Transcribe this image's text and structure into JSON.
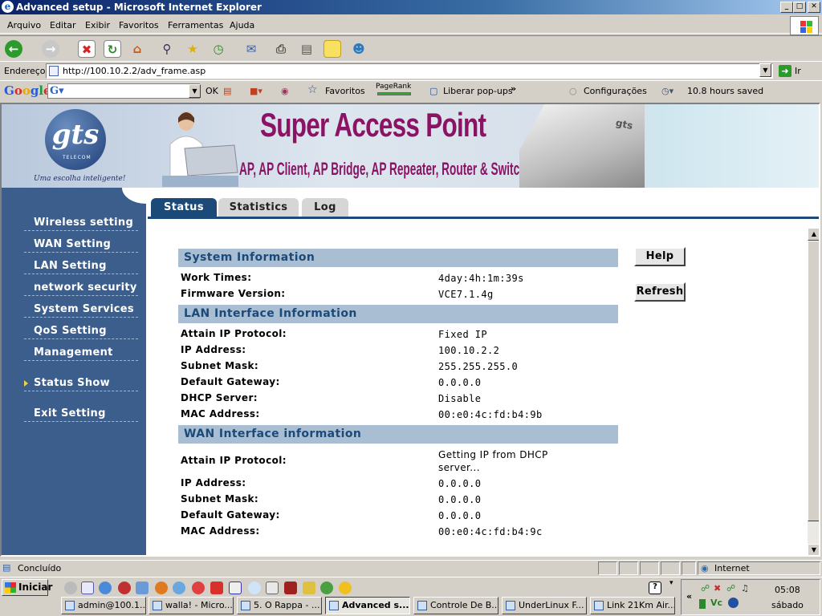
{
  "window": {
    "title": "Advanced setup - Microsoft Internet Explorer",
    "controls": {
      "minimize": "_",
      "maximize": "□",
      "close": "✕"
    }
  },
  "menu": [
    "Arquivo",
    "Editar",
    "Exibir",
    "Favoritos",
    "Ferramentas",
    "Ajuda"
  ],
  "address": {
    "label": "Endereço",
    "url": "http://100.10.2.2/adv_frame.asp",
    "go": "Ir"
  },
  "google_bar": {
    "logo": "Google",
    "ok": "OK",
    "favoritos": "Favoritos",
    "pagerank": "PageRank",
    "popups": "Liberar pop-ups",
    "config": "Configurações",
    "saved": "10.8 hours saved"
  },
  "banner": {
    "logo": "gts",
    "logo_sub": "TELECOM",
    "slogan": "Uma escolha inteligente!",
    "title": "Super Access Point",
    "subtitle": "AP, AP Client, AP Bridge, AP Repeater, Router & Switch",
    "device_brand": "gts"
  },
  "sidebar": {
    "items": [
      {
        "label": "Wireless setting",
        "active": false
      },
      {
        "label": "WAN Setting",
        "active": false
      },
      {
        "label": "LAN Setting",
        "active": false
      },
      {
        "label": "network security",
        "active": false
      },
      {
        "label": "System Services",
        "active": false
      },
      {
        "label": "QoS Setting",
        "active": false
      },
      {
        "label": "Management",
        "active": false
      },
      {
        "label": "Status Show",
        "active": true
      },
      {
        "label": "Exit Setting",
        "active": false
      }
    ]
  },
  "tabs": [
    {
      "label": "Status",
      "active": true
    },
    {
      "label": "Statistics",
      "active": false
    },
    {
      "label": "Log",
      "active": false
    }
  ],
  "buttons": {
    "help": "Help",
    "refresh": "Refresh"
  },
  "system": {
    "heading": "System Information",
    "rows": [
      {
        "key": "Work Times:",
        "value": "4day:4h:1m:39s"
      },
      {
        "key": "Firmware Version:",
        "value": "VCE7.1.4g"
      }
    ]
  },
  "lan": {
    "heading": "LAN Interface Information",
    "rows": [
      {
        "key": "Attain IP Protocol:",
        "value": "Fixed IP"
      },
      {
        "key": "IP Address:",
        "value": "100.10.2.2"
      },
      {
        "key": "Subnet Mask:",
        "value": "255.255.255.0"
      },
      {
        "key": "Default Gateway:",
        "value": "0.0.0.0"
      },
      {
        "key": "DHCP Server:",
        "value": "Disable"
      },
      {
        "key": "MAC Address:",
        "value": "00:e0:4c:fd:b4:9b"
      }
    ]
  },
  "wan": {
    "heading": "WAN Interface information",
    "rows": [
      {
        "key": "Attain IP Protocol:",
        "value": "Getting IP from DHCP server..."
      },
      {
        "key": "IP Address:",
        "value": "0.0.0.0"
      },
      {
        "key": "Subnet Mask:",
        "value": "0.0.0.0"
      },
      {
        "key": "Default Gateway:",
        "value": "0.0.0.0"
      },
      {
        "key": "MAC Address:",
        "value": "00:e0:4c:fd:b4:9c"
      }
    ]
  },
  "status_bar": {
    "left": "Concluído",
    "zone": "Internet"
  },
  "taskbar": {
    "start": "Iniciar",
    "tasks": [
      {
        "label": "admin@100.1...",
        "active": false
      },
      {
        "label": "walla! - Micro...",
        "active": false
      },
      {
        "label": "5. O Rappa - ...",
        "active": false
      },
      {
        "label": "Advanced s...",
        "active": true
      },
      {
        "label": "Controle De B...",
        "active": false
      },
      {
        "label": "UnderLinux F...",
        "active": false
      },
      {
        "label": "Link 21Km Air...",
        "active": false
      }
    ],
    "tray_chevron": "«",
    "tray_vc": "Vc",
    "clock": "05:08",
    "day": "sábado"
  }
}
